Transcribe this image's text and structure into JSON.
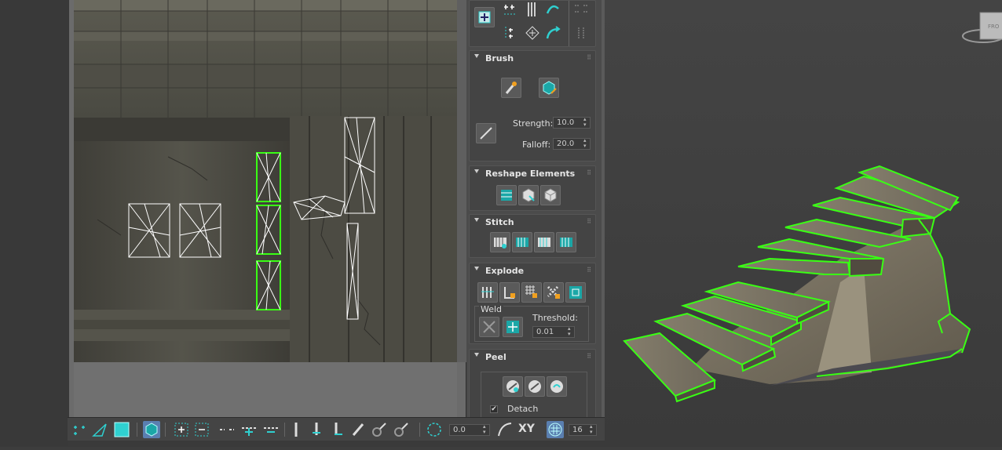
{
  "panel": {
    "brush": {
      "title": "Brush",
      "strength_label": "Strength:",
      "strength_value": "10.0",
      "falloff_label": "Falloff:",
      "falloff_value": "20.0"
    },
    "reshape": {
      "title": "Reshape Elements"
    },
    "stitch": {
      "title": "Stitch"
    },
    "explode": {
      "title": "Explode",
      "weld_label": "Weld",
      "threshold_label": "Threshold:",
      "threshold_value": "0.01"
    },
    "peel": {
      "title": "Peel",
      "detach_label": "Detach",
      "detach_checked": true
    }
  },
  "toolbar": {
    "rotate_value": "0.0",
    "xy_label": "XY",
    "snap_value": "16"
  },
  "colors": {
    "selection_green": "#39ff14",
    "accent_cyan": "#2fd0d0",
    "panel_bg": "#4b4b4b"
  }
}
